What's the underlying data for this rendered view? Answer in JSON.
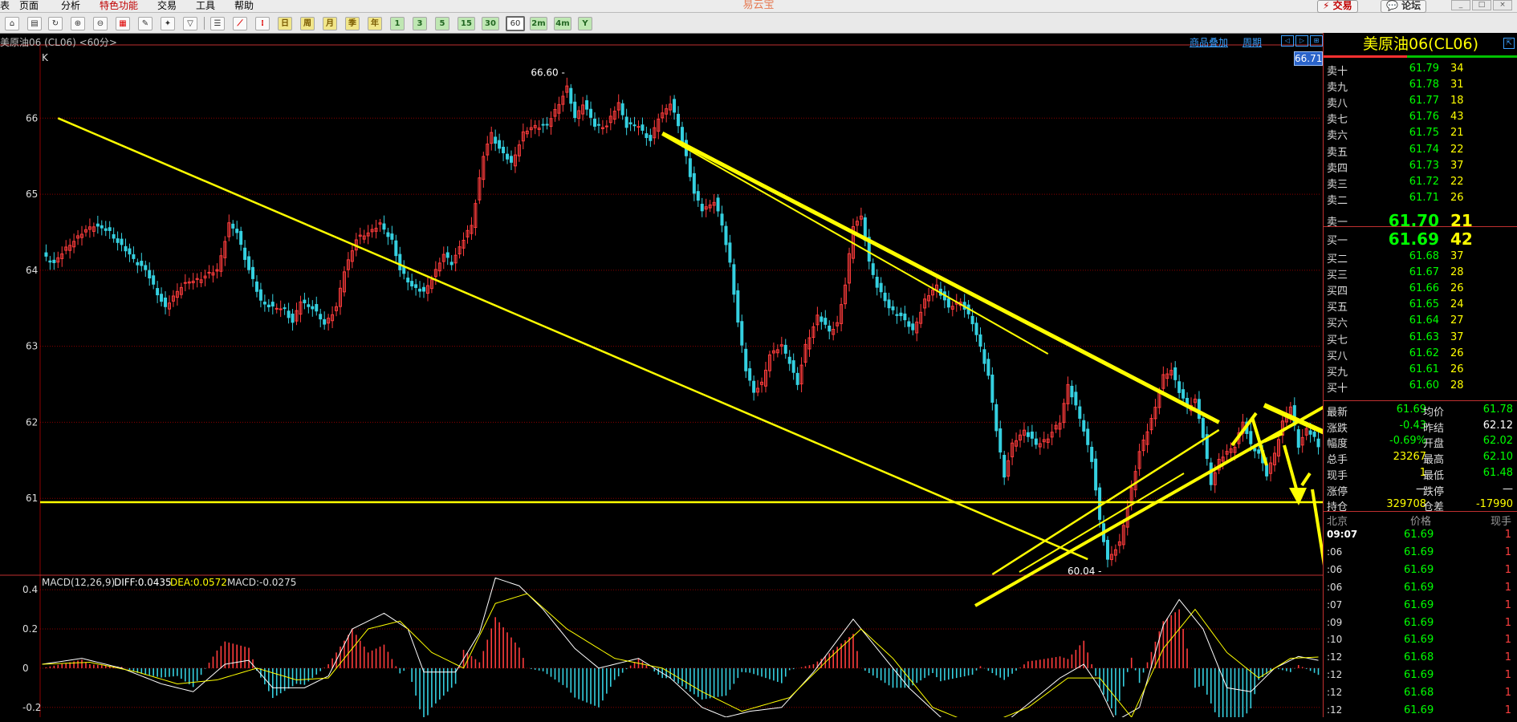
{
  "menu": {
    "items": [
      "页面",
      "分析",
      "特色功能",
      "交易",
      "工具",
      "帮助"
    ],
    "cut_item": "表",
    "highlight_index": 2,
    "app_title": "易云宝",
    "trade_btn": "交易",
    "forum_btn": "论坛"
  },
  "toolbar": {
    "periods": [
      "日",
      "周",
      "月",
      "季",
      "年"
    ],
    "minutes": [
      "1",
      "3",
      "5",
      "15",
      "30",
      "60"
    ],
    "selected_minute": "60",
    "extras": [
      "2m",
      "4m",
      "Y"
    ]
  },
  "chart": {
    "info": "美原油06 (CL06) <60分>",
    "indicator_label": "K",
    "link_overlay": "商品叠加",
    "link_period": "周期",
    "price_tag": "66.71",
    "high_label": "66.60",
    "low_label": "60.04",
    "macd": {
      "name": "MACD(12,26,9)",
      "diff": "DIFF:0.0435",
      "dea": "DEA:0.0572",
      "macd": "MACD:-0.0275"
    }
  },
  "chart_data": {
    "type": "candlestick",
    "x_unit": "60-minute bars (unlabeled)",
    "y_ticks": [
      66,
      65,
      64,
      63,
      62,
      61
    ],
    "ylim": [
      60.0,
      66.9
    ],
    "price_path": [
      [
        0,
        64.2
      ],
      [
        3,
        64.1
      ],
      [
        8,
        64.4
      ],
      [
        13,
        64.6
      ],
      [
        17,
        64.5
      ],
      [
        22,
        64.2
      ],
      [
        26,
        64.0
      ],
      [
        29,
        63.7
      ],
      [
        31,
        63.5
      ],
      [
        35,
        63.8
      ],
      [
        40,
        63.9
      ],
      [
        44,
        64.0
      ],
      [
        47,
        64.6
      ],
      [
        49,
        64.5
      ],
      [
        52,
        64.0
      ],
      [
        55,
        63.6
      ],
      [
        58,
        63.5
      ],
      [
        61,
        63.5
      ],
      [
        63,
        63.3
      ],
      [
        65,
        63.6
      ],
      [
        68,
        63.5
      ],
      [
        71,
        63.3
      ],
      [
        74,
        63.5
      ],
      [
        76,
        64.0
      ],
      [
        79,
        64.4
      ],
      [
        82,
        64.5
      ],
      [
        85,
        64.6
      ],
      [
        88,
        64.4
      ],
      [
        90,
        64.0
      ],
      [
        93,
        63.8
      ],
      [
        96,
        63.7
      ],
      [
        98,
        63.9
      ],
      [
        101,
        64.2
      ],
      [
        103,
        64.1
      ],
      [
        106,
        64.4
      ],
      [
        108,
        64.6
      ],
      [
        111,
        65.5
      ],
      [
        113,
        65.8
      ],
      [
        115,
        65.6
      ],
      [
        118,
        65.4
      ],
      [
        121,
        65.8
      ],
      [
        124,
        65.9
      ],
      [
        127,
        65.9
      ],
      [
        130,
        66.2
      ],
      [
        132,
        66.4
      ],
      [
        134,
        66.0
      ],
      [
        136,
        66.2
      ],
      [
        139,
        65.9
      ],
      [
        142,
        65.9
      ],
      [
        145,
        66.2
      ],
      [
        147,
        65.9
      ],
      [
        150,
        65.9
      ],
      [
        153,
        65.7
      ],
      [
        155,
        66.0
      ],
      [
        158,
        66.2
      ],
      [
        160,
        65.9
      ],
      [
        162,
        65.5
      ],
      [
        164,
        65.0
      ],
      [
        166,
        64.8
      ],
      [
        169,
        64.9
      ],
      [
        171,
        64.6
      ],
      [
        173,
        64.1
      ],
      [
        175,
        63.3
      ],
      [
        177,
        62.7
      ],
      [
        179,
        62.4
      ],
      [
        181,
        62.5
      ],
      [
        183,
        62.9
      ],
      [
        186,
        63.0
      ],
      [
        188,
        62.8
      ],
      [
        190,
        62.5
      ],
      [
        192,
        63.0
      ],
      [
        195,
        63.4
      ],
      [
        198,
        63.2
      ],
      [
        200,
        63.3
      ],
      [
        202,
        63.8
      ],
      [
        204,
        64.6
      ],
      [
        206,
        64.7
      ],
      [
        208,
        64.1
      ],
      [
        210,
        63.8
      ],
      [
        213,
        63.5
      ],
      [
        216,
        63.4
      ],
      [
        219,
        63.2
      ],
      [
        222,
        63.6
      ],
      [
        225,
        63.8
      ],
      [
        228,
        63.5
      ],
      [
        231,
        63.6
      ],
      [
        234,
        63.3
      ],
      [
        236,
        63.0
      ],
      [
        238,
        62.6
      ],
      [
        240,
        61.9
      ],
      [
        242,
        61.3
      ],
      [
        244,
        61.7
      ],
      [
        247,
        61.9
      ],
      [
        250,
        61.7
      ],
      [
        253,
        61.8
      ],
      [
        256,
        62.0
      ],
      [
        258,
        62.5
      ],
      [
        260,
        62.2
      ],
      [
        262,
        61.9
      ],
      [
        264,
        61.5
      ],
      [
        266,
        60.7
      ],
      [
        268,
        60.2
      ],
      [
        271,
        60.4
      ],
      [
        273,
        60.9
      ],
      [
        276,
        61.6
      ],
      [
        278,
        61.9
      ],
      [
        280,
        62.2
      ],
      [
        282,
        62.6
      ],
      [
        284,
        62.7
      ],
      [
        286,
        62.4
      ],
      [
        288,
        62.2
      ],
      [
        290,
        62.3
      ],
      [
        292,
        61.8
      ],
      [
        294,
        61.2
      ],
      [
        296,
        61.5
      ],
      [
        298,
        61.6
      ],
      [
        300,
        61.7
      ],
      [
        302,
        62.0
      ],
      [
        304,
        61.7
      ],
      [
        306,
        61.6
      ],
      [
        308,
        61.3
      ],
      [
        310,
        61.6
      ],
      [
        312,
        62.0
      ],
      [
        314,
        62.2
      ],
      [
        316,
        61.7
      ],
      [
        318,
        61.9
      ],
      [
        320,
        61.8
      ],
      [
        321,
        61.69
      ]
    ],
    "trendlines": [
      {
        "from": [
          4,
          66.0
        ],
        "to": [
          263,
          60.2
        ]
      },
      {
        "from": [
          156,
          65.8
        ],
        "to": [
          296,
          62.0
        ]
      },
      {
        "from": [
          239,
          60.0
        ],
        "to": [
          296,
          61.9
        ]
      }
    ],
    "horizontal_line": 60.95,
    "high": 66.6,
    "low": 60.04,
    "macd": {
      "y_ticks": [
        0.4,
        0.2,
        0,
        -0.2
      ],
      "ylim": [
        -0.25,
        0.47
      ],
      "diff_path": [
        [
          0,
          0.02
        ],
        [
          10,
          0.05
        ],
        [
          20,
          0.0
        ],
        [
          30,
          -0.08
        ],
        [
          38,
          -0.12
        ],
        [
          46,
          0.02
        ],
        [
          52,
          0.04
        ],
        [
          58,
          -0.1
        ],
        [
          66,
          -0.1
        ],
        [
          72,
          -0.04
        ],
        [
          78,
          0.2
        ],
        [
          86,
          0.28
        ],
        [
          92,
          0.2
        ],
        [
          96,
          -0.02
        ],
        [
          104,
          -0.02
        ],
        [
          110,
          0.18
        ],
        [
          114,
          0.46
        ],
        [
          120,
          0.42
        ],
        [
          126,
          0.3
        ],
        [
          134,
          0.1
        ],
        [
          140,
          0.0
        ],
        [
          150,
          0.05
        ],
        [
          158,
          -0.05
        ],
        [
          166,
          -0.2
        ],
        [
          172,
          -0.25
        ],
        [
          178,
          -0.22
        ],
        [
          186,
          -0.2
        ],
        [
          194,
          -0.02
        ],
        [
          204,
          0.25
        ],
        [
          210,
          0.1
        ],
        [
          218,
          -0.1
        ],
        [
          226,
          -0.25
        ],
        [
          234,
          -0.3
        ],
        [
          242,
          -0.28
        ],
        [
          250,
          -0.15
        ],
        [
          256,
          -0.05
        ],
        [
          262,
          0.02
        ],
        [
          266,
          -0.1
        ],
        [
          270,
          -0.27
        ],
        [
          276,
          -0.2
        ],
        [
          282,
          0.22
        ],
        [
          286,
          0.35
        ],
        [
          292,
          0.2
        ],
        [
          298,
          -0.1
        ],
        [
          304,
          -0.12
        ],
        [
          310,
          0.0
        ],
        [
          316,
          0.06
        ],
        [
          321,
          0.04
        ]
      ],
      "dea_path": [
        [
          0,
          0.02
        ],
        [
          12,
          0.03
        ],
        [
          24,
          -0.02
        ],
        [
          34,
          -0.08
        ],
        [
          44,
          -0.06
        ],
        [
          54,
          0.0
        ],
        [
          64,
          -0.06
        ],
        [
          72,
          -0.05
        ],
        [
          82,
          0.2
        ],
        [
          90,
          0.24
        ],
        [
          98,
          0.08
        ],
        [
          106,
          0.0
        ],
        [
          114,
          0.33
        ],
        [
          122,
          0.38
        ],
        [
          132,
          0.2
        ],
        [
          144,
          0.05
        ],
        [
          156,
          0.0
        ],
        [
          166,
          -0.12
        ],
        [
          176,
          -0.22
        ],
        [
          188,
          -0.15
        ],
        [
          198,
          0.05
        ],
        [
          206,
          0.2
        ],
        [
          214,
          0.05
        ],
        [
          224,
          -0.2
        ],
        [
          236,
          -0.3
        ],
        [
          248,
          -0.2
        ],
        [
          258,
          -0.05
        ],
        [
          266,
          -0.05
        ],
        [
          274,
          -0.25
        ],
        [
          282,
          0.1
        ],
        [
          290,
          0.3
        ],
        [
          298,
          0.08
        ],
        [
          306,
          -0.05
        ],
        [
          314,
          0.05
        ],
        [
          321,
          0.057
        ]
      ]
    }
  },
  "panel": {
    "title": "美原油06(CL06)",
    "asks": [
      {
        "label": "卖十",
        "price": "61.79",
        "vol": "34"
      },
      {
        "label": "卖九",
        "price": "61.78",
        "vol": "31"
      },
      {
        "label": "卖八",
        "price": "61.77",
        "vol": "18"
      },
      {
        "label": "卖七",
        "price": "61.76",
        "vol": "43"
      },
      {
        "label": "卖六",
        "price": "61.75",
        "vol": "21"
      },
      {
        "label": "卖五",
        "price": "61.74",
        "vol": "22"
      },
      {
        "label": "卖四",
        "price": "61.73",
        "vol": "37"
      },
      {
        "label": "卖三",
        "price": "61.72",
        "vol": "22"
      },
      {
        "label": "卖二",
        "price": "61.71",
        "vol": "26"
      },
      {
        "label": "卖一",
        "price": "61.70",
        "vol": "21"
      }
    ],
    "bids": [
      {
        "label": "买一",
        "price": "61.69",
        "vol": "42"
      },
      {
        "label": "买二",
        "price": "61.68",
        "vol": "37"
      },
      {
        "label": "买三",
        "price": "61.67",
        "vol": "28"
      },
      {
        "label": "买四",
        "price": "61.66",
        "vol": "26"
      },
      {
        "label": "买五",
        "price": "61.65",
        "vol": "24"
      },
      {
        "label": "买六",
        "price": "61.64",
        "vol": "27"
      },
      {
        "label": "买七",
        "price": "61.63",
        "vol": "37"
      },
      {
        "label": "买八",
        "price": "61.62",
        "vol": "26"
      },
      {
        "label": "买九",
        "price": "61.61",
        "vol": "26"
      },
      {
        "label": "买十",
        "price": "61.60",
        "vol": "28"
      }
    ],
    "stats": [
      {
        "l1": "最新",
        "v1": "61.69",
        "c1": "green",
        "l2": "均价",
        "v2": "61.78",
        "c2": "green"
      },
      {
        "l1": "涨跌",
        "v1": "-0.43",
        "c1": "green",
        "l2": "昨结",
        "v2": "62.12",
        "c2": "white"
      },
      {
        "l1": "幅度",
        "v1": "-0.69%",
        "c1": "green",
        "l2": "开盘",
        "v2": "62.02",
        "c2": "green"
      },
      {
        "l1": "总手",
        "v1": "23267",
        "c1": "yellow",
        "l2": "最高",
        "v2": "62.10",
        "c2": "green"
      },
      {
        "l1": "现手",
        "v1": "1",
        "c1": "yellow",
        "l2": "最低",
        "v2": "61.48",
        "c2": "green"
      },
      {
        "l1": "涨停",
        "v1": "—",
        "c1": "white",
        "l2": "跌停",
        "v2": "—",
        "c2": "white"
      },
      {
        "l1": "持仓",
        "v1": "329708",
        "c1": "yellow",
        "l2": "仓差",
        "v2": "-17990",
        "c2": "yellow"
      }
    ],
    "ticks_header": {
      "time": "北京",
      "price": "价格",
      "vol": "现手"
    },
    "ticks": [
      {
        "t": "09:07",
        "p": "61.69",
        "v": "1"
      },
      {
        "t": ":06",
        "p": "61.69",
        "v": "1"
      },
      {
        "t": ":06",
        "p": "61.69",
        "v": "1"
      },
      {
        "t": ":06",
        "p": "61.69",
        "v": "1"
      },
      {
        "t": ":07",
        "p": "61.69",
        "v": "1"
      },
      {
        "t": ":09",
        "p": "61.69",
        "v": "1"
      },
      {
        "t": ":10",
        "p": "61.69",
        "v": "1"
      },
      {
        "t": ":12",
        "p": "61.68",
        "v": "1"
      },
      {
        "t": ":12",
        "p": "61.69",
        "v": "1"
      },
      {
        "t": ":12",
        "p": "61.68",
        "v": "1"
      },
      {
        "t": ":12",
        "p": "61.69",
        "v": "1"
      }
    ]
  },
  "colors": {
    "up": "#ff3c3c",
    "down": "#35d0e0",
    "trend": "#ffff00",
    "grid": "#8b0000",
    "diff": "#ffffff",
    "dea": "#ffff00"
  }
}
